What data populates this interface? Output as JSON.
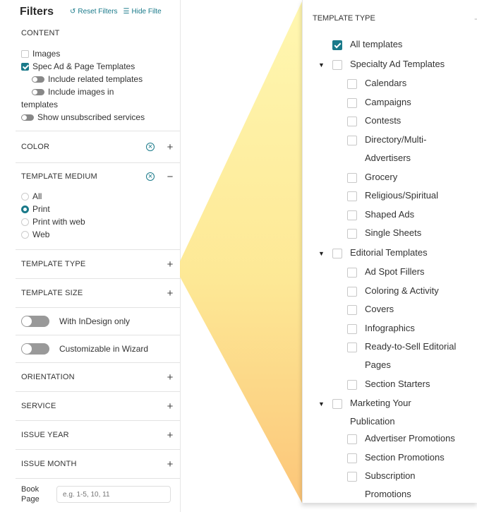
{
  "header": {
    "title": "Filters",
    "reset_label": "Reset Filters",
    "hide_label": "Hide Filte"
  },
  "content": {
    "heading": "CONTENT",
    "images": "Images",
    "spec_ad": "Spec Ad & Page Templates",
    "include_related": "Include related templates",
    "include_images_line1": "Include images in",
    "include_images_line2": "templates",
    "show_unsubscribed": "Show unsubscribed services"
  },
  "sections": {
    "color": "COLOR",
    "template_medium": "TEMPLATE MEDIUM",
    "template_type": "TEMPLATE TYPE",
    "template_size": "TEMPLATE SIZE",
    "orientation": "ORIENTATION",
    "service": "SERVICE",
    "issue_year": "ISSUE YEAR",
    "issue_month": "ISSUE MONTH"
  },
  "medium_options": [
    "All",
    "Print",
    "Print with web",
    "Web"
  ],
  "medium_selected": "Print",
  "toggles": {
    "indesign": "With InDesign only",
    "wizard": "Customizable in Wizard"
  },
  "book_page": {
    "label_line1": "Book",
    "label_line2": "Page",
    "placeholder": "e.g. 1-5, 10, 11"
  },
  "template_type_panel": {
    "heading": "TEMPLATE TYPE",
    "all": "All templates",
    "groups": [
      {
        "name": "Specialty Ad Templates",
        "items": [
          "Calendars",
          "Campaigns",
          "Contests",
          "Directory/Multi-Advertisers",
          "Grocery",
          "Religious/Spiritual",
          "Shaped Ads",
          "Single Sheets"
        ]
      },
      {
        "name": "Editorial Templates",
        "items": [
          "Ad Spot Fillers",
          "Coloring & Activity",
          "Covers",
          "Infographics",
          "Ready-to-Sell Editorial Pages",
          "Section Starters"
        ]
      },
      {
        "name": "Marketing Your Publication",
        "items": [
          "Advertiser Promotions",
          "Section Promotions",
          "Subscription Promotions"
        ]
      }
    ]
  },
  "colors": {
    "accent": "#1a7a8a",
    "highlight": "#fcd34d"
  }
}
